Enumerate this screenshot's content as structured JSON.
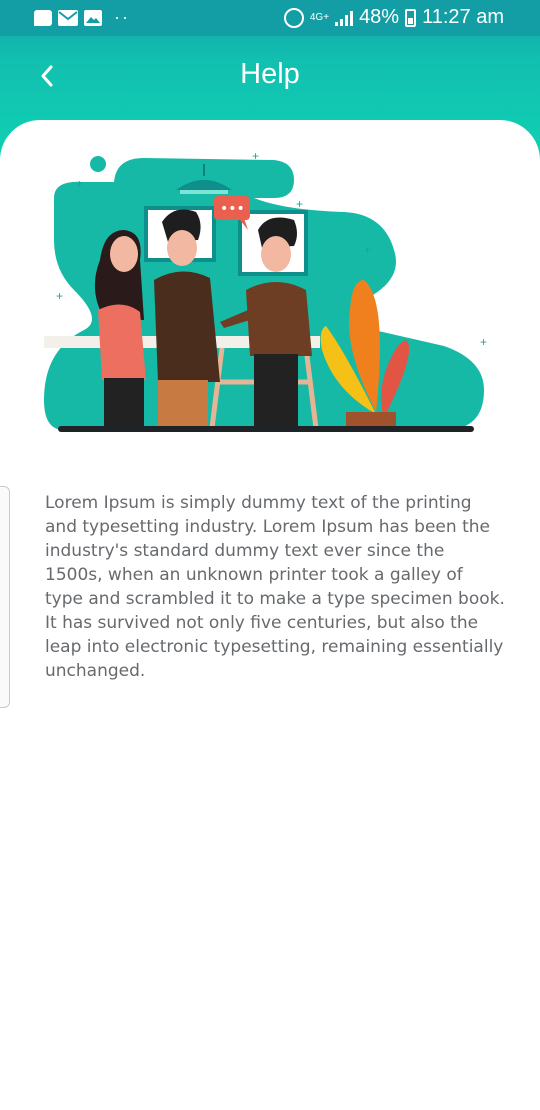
{
  "status_bar": {
    "network": "4G+",
    "battery": "48%",
    "time": "11:27 am",
    "dots": "··",
    "icons": [
      "chat-icon",
      "mail-icon",
      "image-icon",
      "alarm-icon",
      "signal-icon",
      "battery-icon"
    ]
  },
  "header": {
    "title": "Help",
    "back_icon": "chevron-left-icon"
  },
  "content": {
    "illustration": "team-meeting-illustration",
    "speech_bubble": "•••",
    "body": "Lorem Ipsum is simply dummy text of the printing and typesetting industry. Lorem Ipsum has been the industry's standard dummy text ever since the 1500s, when an unknown printer took a galley of type and scrambled it to make a type specimen book. It has survived not only five centuries, but also the leap into electronic typesetting, remaining essentially unchanged."
  },
  "colors": {
    "header_top": "#13a3a8",
    "header_bottom": "#0fd3b4",
    "body_text": "#666a6e",
    "teal_blob": "#16b9a6"
  }
}
